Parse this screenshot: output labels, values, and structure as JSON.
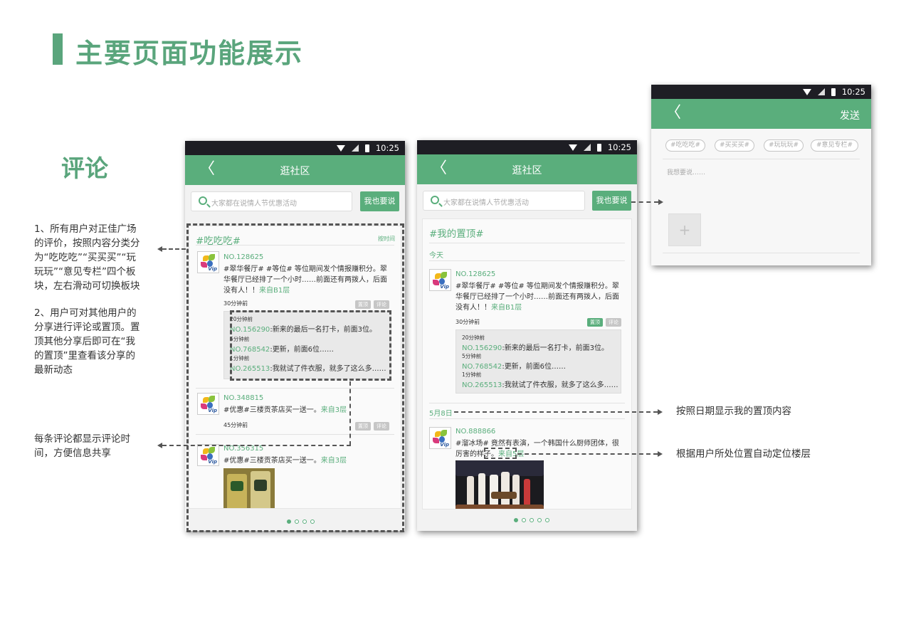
{
  "page": {
    "title": "主要页面功能展示",
    "section": "评论"
  },
  "notes": {
    "left1": [
      "1、所有用户对正佳广场",
      "的评价，按照内容分类分",
      "为“吃吃吃”“买买买”“玩",
      "玩玩”“意见专栏”四个板",
      "块，左右滑动可切换板块"
    ],
    "left2": [
      "2、用户可对其他用户的",
      "分享进行评论或置顶。置",
      "顶其他分享后即可在“我",
      "的置顶”里查看该分享的",
      "最新动态"
    ],
    "left3": [
      "每条评论都显示评论时",
      "间，方便信息共享"
    ],
    "right1": "按照日期显示我的置顶内容",
    "right2": "根据用户所处位置自动定位楼层"
  },
  "status": {
    "time": "10:25"
  },
  "phone1": {
    "back": "〈",
    "title": "逛社区",
    "search_placeholder": "大家都在说情人节优惠活动",
    "post_button": "我也要说",
    "category": "#吃吃吃#",
    "sort": "按时间",
    "posts": [
      {
        "no": "NO.128625",
        "text": "#翠华餐厅# #等位# 等位期间发个情报赚积分。翠华餐厅已经排了一个小时……前面还有两拨人，后面没有人！！",
        "from": "来自B1层",
        "time": "30分钟前",
        "pin": "置顶",
        "comment": "评论"
      },
      {
        "no": "NO.348815",
        "text": "#优惠#三楼贡茶店买一送一。",
        "from": "来自3层",
        "time": "45分钟前",
        "pin": "置顶",
        "comment": "评论"
      },
      {
        "no": "NO.356315",
        "text": "#优惠#三楼贡茶店买一送一。",
        "from": "来自3层"
      }
    ],
    "replies": [
      {
        "time": "20分钟前",
        "no": "NO.156290",
        "text": "新来的最后一名打卡，前面3位。"
      },
      {
        "time": "5分钟前",
        "no": "NO.768542",
        "text": "更新，前面6位……"
      },
      {
        "time": "1分钟前",
        "no": "NO.265513",
        "text": "我就试了件衣服，就多了这么多……"
      }
    ]
  },
  "phone2": {
    "back": "〈",
    "title": "逛社区",
    "search_placeholder": "大家都在说情人节优惠活动",
    "post_button": "我也要说",
    "category": "#我的置顶#",
    "today": "今天",
    "post1": {
      "no": "NO.128625",
      "text": "#翠华餐厅# #等位# 等位期间发个情报赚积分。翠华餐厅已经排了一个小时……前面还有两拨人，后面没有人！！",
      "from": "来自B1层",
      "time": "30分钟前",
      "pin": "置顶",
      "comment": "评论"
    },
    "replies": [
      {
        "time": "20分钟前",
        "no": "NO.156290",
        "text": "新来的最后一名打卡，前面3位。"
      },
      {
        "time": "5分钟前",
        "no": "NO.768542",
        "text": "更新，前面6位……"
      },
      {
        "time": "1分钟前",
        "no": "NO.265513",
        "text": "我就试了件衣服，就多了这么多……"
      }
    ],
    "date2": "5月8日",
    "post2": {
      "no": "NO.888866",
      "text": "#溜冰场# 竟然有表演，一个韩国什么厨师团体，很厉害的样子。",
      "from": "来自5层"
    }
  },
  "phone3": {
    "back": "〈",
    "send": "发送",
    "tags": [
      "#吃吃吃#",
      "#买买买#",
      "#玩玩玩#",
      "#意见专栏#"
    ],
    "input_placeholder": "我想要说……",
    "add": "+"
  },
  "colors": {
    "accent": "#5aae7c",
    "title": "#5aa57c",
    "statusbar": "#1e1e24"
  }
}
